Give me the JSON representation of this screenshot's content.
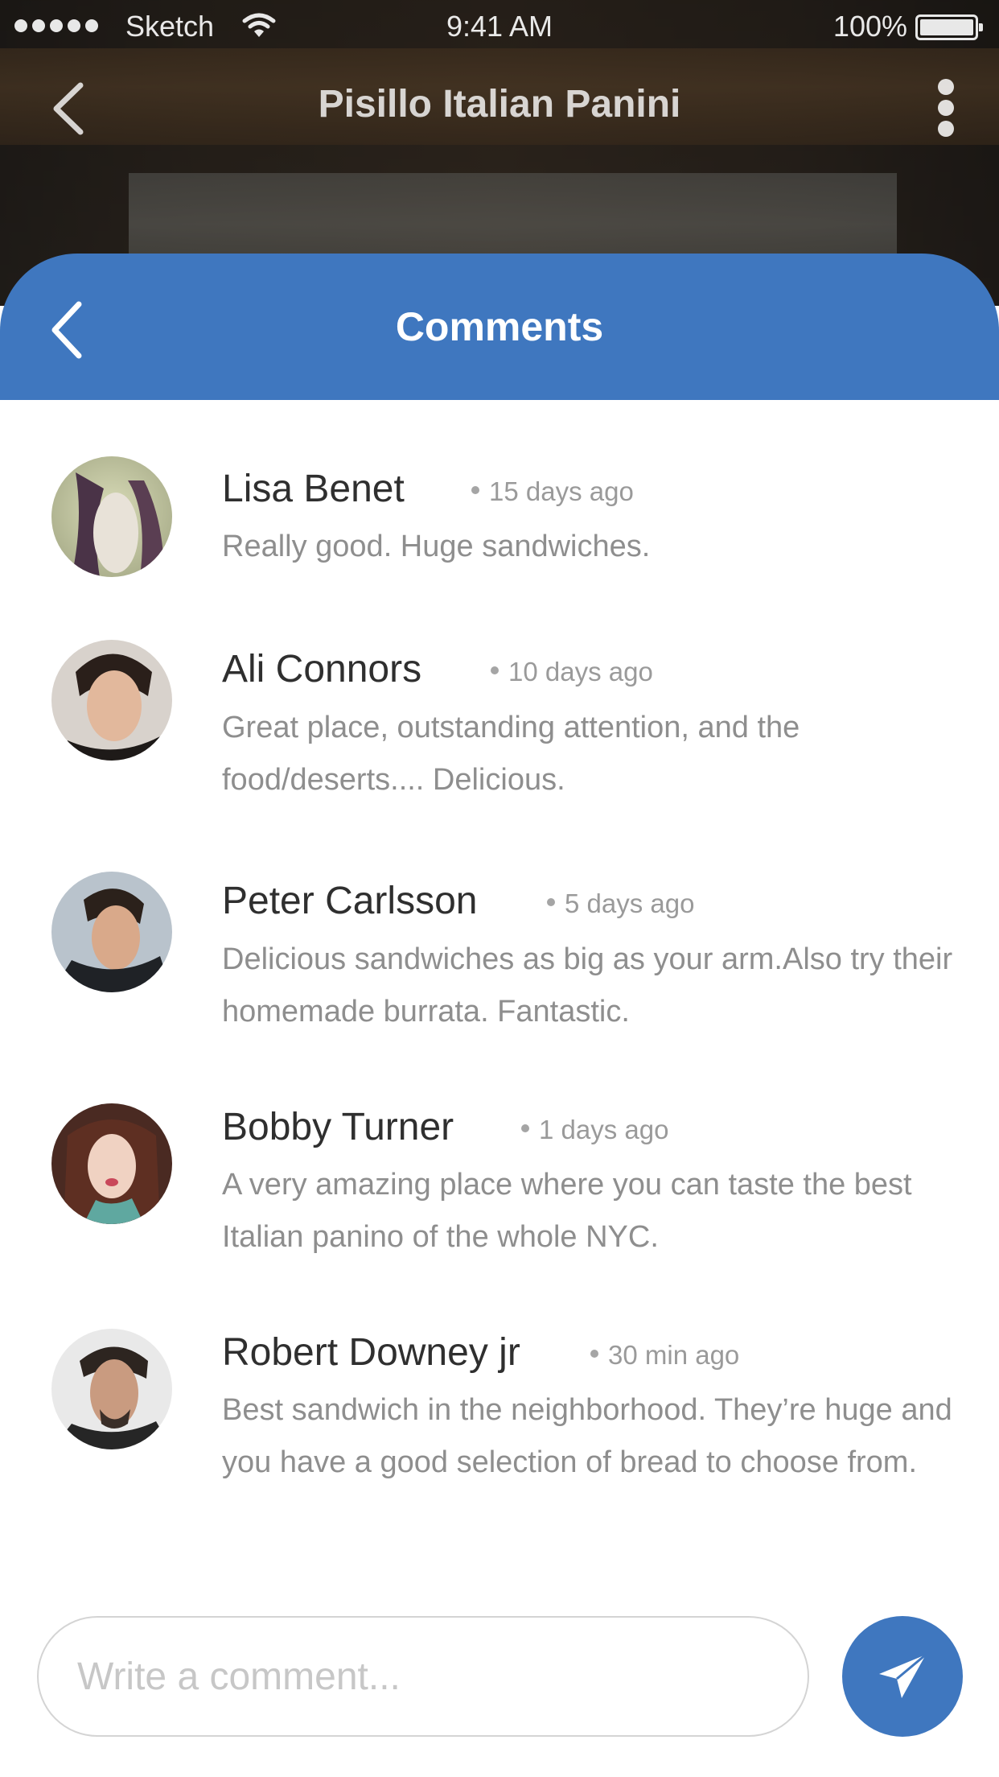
{
  "status_bar": {
    "carrier": "Sketch",
    "time": "9:41 AM",
    "battery": "100%"
  },
  "top_nav": {
    "title": "Pisillo Italian Panini"
  },
  "sheet": {
    "title": "Comments"
  },
  "comments": [
    {
      "name": "Lisa Benet",
      "time": "15 days ago",
      "text": "Really good. Huge sandwiches."
    },
    {
      "name": "Ali Connors",
      "time": "10 days ago",
      "text": "Great place, outstanding attention, and the food/deserts.... Delicious."
    },
    {
      "name": "Peter Carlsson",
      "time": "5 days ago",
      "text": "Delicious sandwiches as big as your arm.Also try their homemade burrata. Fantastic."
    },
    {
      "name": "Bobby Turner",
      "time": "1 days ago",
      "text": "A very amazing place where you can taste the best Italian panino of the whole NYC."
    },
    {
      "name": "Robert Downey jr",
      "time": "30 min ago",
      "text": "Best sandwich in the neighborhood. They’re huge and you have a good selection of bread to choose from."
    }
  ],
  "composer": {
    "placeholder": "Write a comment...",
    "value": ""
  },
  "colors": {
    "accent": "#3f77bf",
    "name_text": "#2f2f2f",
    "body_text": "#8e8e8e",
    "meta_text": "#9a9a9a"
  },
  "icons": {
    "nav_back": "chevron-left-icon",
    "nav_more": "more-vertical-icon",
    "send": "send-icon"
  }
}
